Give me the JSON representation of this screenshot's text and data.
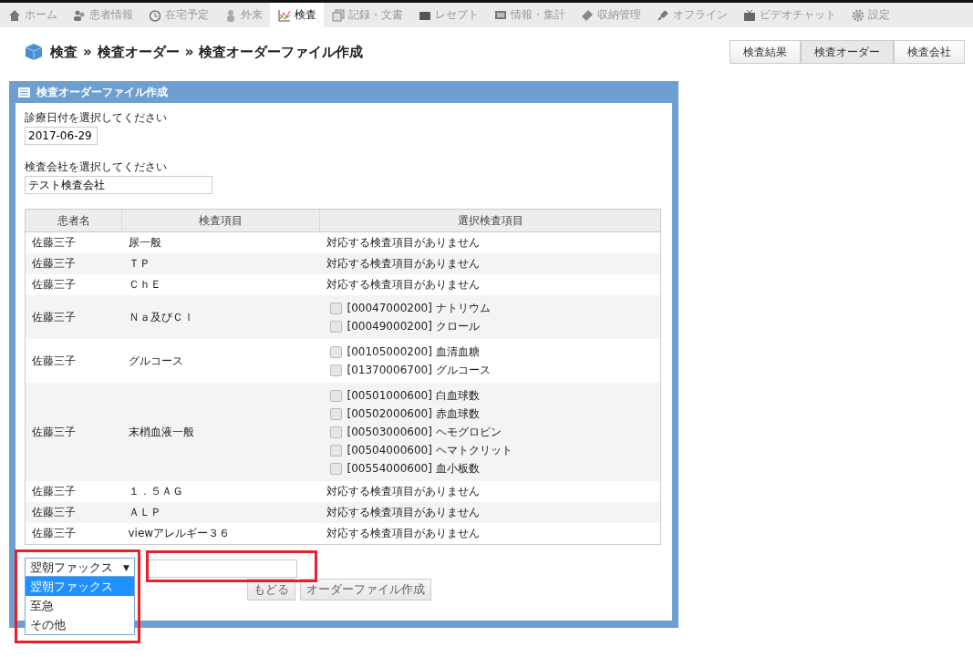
{
  "nav": [
    {
      "label": "ホーム",
      "selected": false
    },
    {
      "label": "患者情報",
      "selected": false
    },
    {
      "label": "在宅予定",
      "selected": false
    },
    {
      "label": "外来",
      "selected": false
    },
    {
      "label": "検査",
      "selected": true
    },
    {
      "label": "記録・文書",
      "selected": false
    },
    {
      "label": "レセプト",
      "selected": false
    },
    {
      "label": "情報・集計",
      "selected": false
    },
    {
      "label": "収納管理",
      "selected": false
    },
    {
      "label": "オフライン",
      "selected": false
    },
    {
      "label": "ビデオチャット",
      "selected": false
    },
    {
      "label": "設定",
      "selected": false
    }
  ],
  "breadcrumb": [
    "検査",
    "検査オーダー",
    "検査オーダーファイル作成"
  ],
  "breadcrumb_separator": "»",
  "view_tabs": [
    {
      "label": "検査結果",
      "selected": false
    },
    {
      "label": "検査オーダー",
      "selected": true
    },
    {
      "label": "検査会社",
      "selected": false
    }
  ],
  "panel": {
    "title": "検査オーダーファイル作成",
    "date_label": "診療日付を選択してください",
    "date_value": "2017-06-29",
    "company_label": "検査会社を選択してください",
    "company_value": "テスト検査会社",
    "table": {
      "columns": [
        "患者名",
        "検査項目",
        "選択検査項目"
      ],
      "rows": [
        {
          "patient": "佐藤三子",
          "test": "尿一般",
          "kind": "none",
          "note": "対応する検査項目がありません"
        },
        {
          "patient": "佐藤三子",
          "test": "ＴＰ",
          "kind": "none",
          "note": "対応する検査項目がありません"
        },
        {
          "patient": "佐藤三子",
          "test": "ＣｈＥ",
          "kind": "none",
          "note": "対応する検査項目がありません"
        },
        {
          "patient": "佐藤三子",
          "test": "Ｎａ及びＣｌ",
          "kind": "options",
          "options": [
            {
              "label": "[00047000200] ナトリウム",
              "checked": false
            },
            {
              "label": "[00049000200] クロール",
              "checked": false
            }
          ]
        },
        {
          "patient": "佐藤三子",
          "test": "グルコース",
          "kind": "options",
          "options": [
            {
              "label": "[00105000200] 血清血糖",
              "checked": false
            },
            {
              "label": "[01370006700] グルコース",
              "checked": false
            }
          ]
        },
        {
          "patient": "佐藤三子",
          "test": "末梢血液一般",
          "kind": "options",
          "options": [
            {
              "label": "[00501000600] 白血球数",
              "checked": false
            },
            {
              "label": "[00502000600] 赤血球数",
              "checked": false
            },
            {
              "label": "[00503000600] ヘモグロビン",
              "checked": false
            },
            {
              "label": "[00504000600] ヘマトクリット",
              "checked": false
            },
            {
              "label": "[00554000600] 血小板数",
              "checked": false
            }
          ]
        },
        {
          "patient": "佐藤三子",
          "test": "１．５ＡＧ",
          "kind": "none",
          "note": "対応する検査項目がありません"
        },
        {
          "patient": "佐藤三子",
          "test": "ＡＬＰ",
          "kind": "none",
          "note": "対応する検査項目がありません"
        },
        {
          "patient": "佐藤三子",
          "test": "viewアレルギー３６",
          "kind": "none",
          "note": "対応する検査項目がありません"
        }
      ]
    },
    "delivery": {
      "value": "翌朝ファックス",
      "caret": "▼",
      "expanded": true,
      "options": [
        {
          "label": "翌朝ファックス",
          "selected": true
        },
        {
          "label": "至急",
          "selected": false
        },
        {
          "label": "その他",
          "selected": false
        }
      ]
    },
    "buttons": [
      "もどる",
      "オーダーファイル作成"
    ]
  }
}
